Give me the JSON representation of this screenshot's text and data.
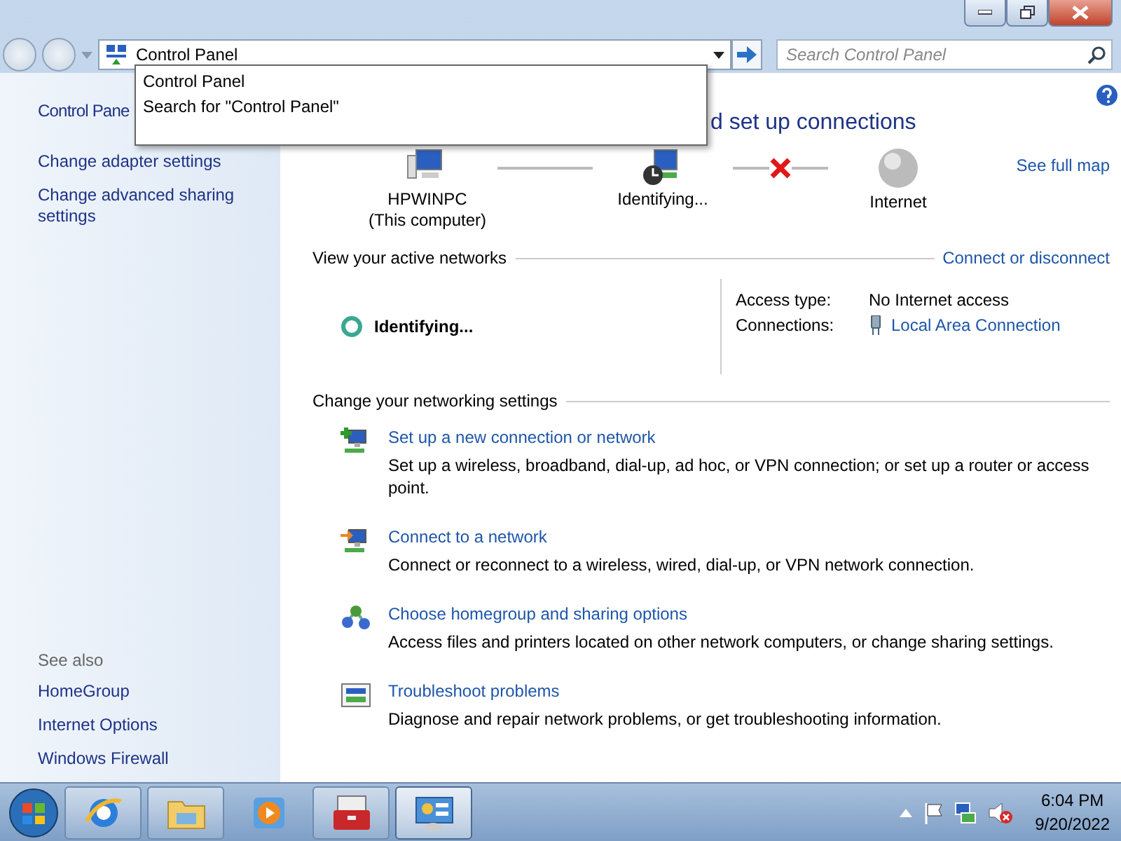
{
  "address_bar": {
    "value": "Control Panel",
    "suggestions": [
      {
        "label": "Control Panel"
      },
      {
        "label": "Search for \"Control Panel\""
      }
    ]
  },
  "search": {
    "placeholder": "Search Control Panel"
  },
  "sidebar": {
    "items": [
      {
        "label": "Control Pane"
      },
      {
        "label": "Change adapter settings"
      },
      {
        "label": "Change advanced sharing settings"
      }
    ],
    "see_also_title": "See also",
    "see_also": [
      {
        "label": "HomeGroup"
      },
      {
        "label": "Internet Options"
      },
      {
        "label": "Windows Firewall"
      }
    ]
  },
  "heading": "d set up connections",
  "map": {
    "nodes": [
      {
        "label": "HPWINPC",
        "sublabel": "(This computer)"
      },
      {
        "label": "Identifying..."
      },
      {
        "label": "Internet"
      }
    ],
    "connectors": [
      {
        "kind": "ok"
      },
      {
        "kind": "broken"
      }
    ],
    "link": "See full map"
  },
  "active_networks": {
    "title": "View your active networks",
    "link": "Connect or disconnect",
    "network_name": "Identifying...",
    "rows": [
      {
        "label": "Access type:",
        "value": "No Internet access",
        "kind": "text"
      },
      {
        "label": "Connections:",
        "value": "Local Area Connection",
        "kind": "link"
      }
    ]
  },
  "settings": {
    "title": "Change your networking settings",
    "tasks": [
      {
        "title": "Set up a new connection or network",
        "description": "Set up a wireless, broadband, dial-up, ad hoc, or VPN connection; or set up a router or access point."
      },
      {
        "title": "Connect to a network",
        "description": "Connect or reconnect to a wireless, wired, dial-up, or VPN network connection."
      },
      {
        "title": "Choose homegroup and sharing options",
        "description": "Access files and printers located on other network computers, or change sharing settings."
      },
      {
        "title": "Troubleshoot problems",
        "description": "Diagnose and repair network problems, or get troubleshooting information."
      }
    ]
  },
  "taskbar": {
    "apps": [
      {
        "running": true,
        "selected": false
      },
      {
        "running": true,
        "selected": false
      },
      {
        "running": false,
        "selected": false
      },
      {
        "running": true,
        "selected": false
      },
      {
        "running": true,
        "selected": true
      }
    ],
    "time": "6:04 PM",
    "date": "9/20/2022"
  }
}
